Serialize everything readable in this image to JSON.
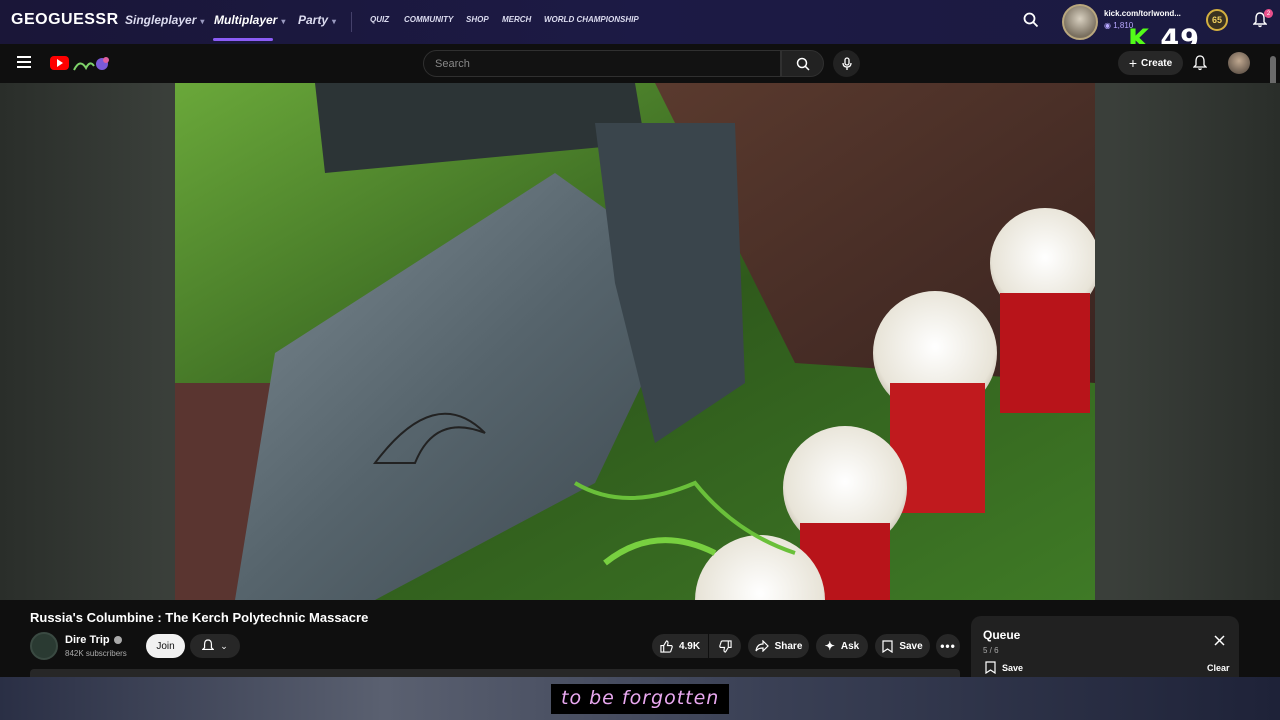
{
  "geoguessr": {
    "logo": "GEOGUESSR",
    "nav": [
      {
        "label": "Singleplayer"
      },
      {
        "label": "Multiplayer"
      },
      {
        "label": "Party"
      }
    ],
    "links": [
      "QUIZ",
      "COMMUNITY",
      "SHOP",
      "MERCH",
      "WORLD CHAMPIONSHIP"
    ],
    "username": "kick.com/torlwond...",
    "coins": "1,810",
    "kick_count": "49",
    "level": "65",
    "notifications": "2",
    "accent": "#8b5cf6"
  },
  "youtube": {
    "search_placeholder": "Search",
    "create_label": "Create",
    "video": {
      "title": "Russia's Columbine : The Kerch Polytechnic Massacre",
      "channel": "Dire Trip",
      "subscribers": "842K subscribers",
      "join_label": "Join",
      "likes": "4.9K",
      "share_label": "Share",
      "ask_label": "Ask",
      "save_label": "Save"
    },
    "queue": {
      "title": "Queue",
      "count": "5 / 6",
      "save_label": "Save",
      "clear_label": "Clear"
    }
  },
  "caption": "to be forgotten"
}
